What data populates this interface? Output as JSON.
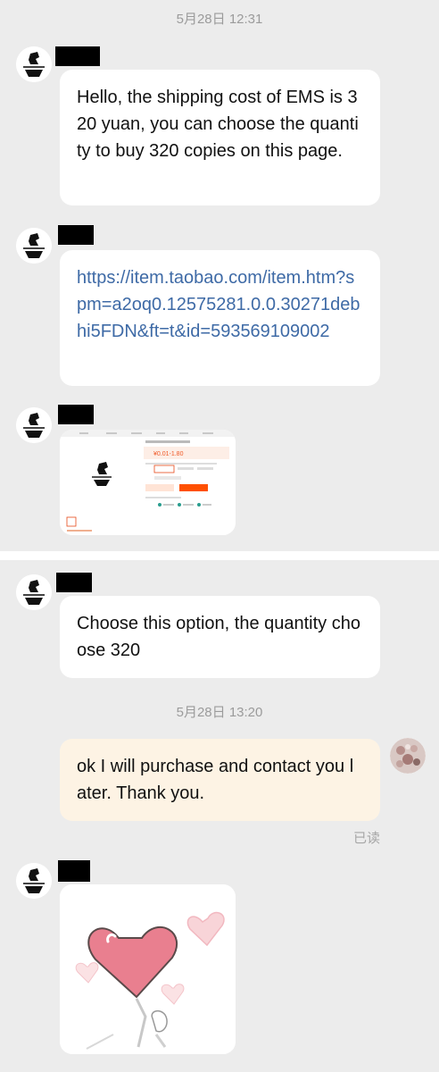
{
  "chat": {
    "timestamp_1": "5月28日 12:31",
    "timestamp_2": "5月28日 13:20",
    "messages": [
      {
        "from": "other",
        "text": "Hello, the shipping cost of EMS is 320 yuan, you can choose the quantity to buy 320 copies on this page."
      },
      {
        "from": "other",
        "text": "https://item.taobao.com/item.htm?spm=a2oq0.12575281.0.0.30271debhi5FDN&ft=t&id=593569109002"
      },
      {
        "from": "other",
        "type": "image",
        "description_icon": "product-page-screenshot"
      },
      {
        "from": "other",
        "text": "Choose this option, the quantity choose 320"
      },
      {
        "from": "me",
        "text": "ok I will purchase and contact you later. Thank you."
      },
      {
        "from": "other",
        "type": "sticker",
        "description_icon": "heart-sticker"
      }
    ],
    "read_receipt": "已读"
  },
  "colors": {
    "background": "#ececec",
    "incoming_bubble": "#ffffff",
    "outgoing_bubble": "#fdf3e4",
    "link": "#3e6aa6",
    "timestamp": "#9b9b9b"
  },
  "screenshot_thumbnail": {
    "price": "¥0.01-1.80",
    "buy_button": "立即购买",
    "cart_button": "加入购物车"
  }
}
